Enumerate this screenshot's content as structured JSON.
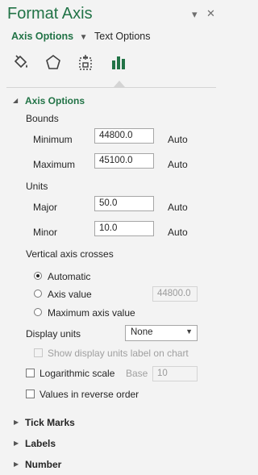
{
  "header": {
    "title": "Format Axis",
    "dropdown_icon": "chevron-down-icon",
    "close_icon": "close-icon"
  },
  "tabs": {
    "axis_options": "Axis Options",
    "text_options": "Text Options"
  },
  "icon_tabs": [
    "fill-line-icon",
    "effects-pentagon-icon",
    "size-properties-icon",
    "axis-options-bar-icon"
  ],
  "axis_options": {
    "section": "Axis Options",
    "bounds_heading": "Bounds",
    "minimum_label": "Minimum",
    "minimum_value": "44800.0",
    "minimum_auto": "Auto",
    "maximum_label": "Maximum",
    "maximum_value": "45100.0",
    "maximum_auto": "Auto",
    "units_heading": "Units",
    "major_label": "Major",
    "major_value": "50.0",
    "major_auto": "Auto",
    "minor_label": "Minor",
    "minor_value": "10.0",
    "minor_auto": "Auto",
    "crosses_heading": "Vertical axis crosses",
    "crosses_automatic": "Automatic",
    "crosses_axis_value": "Axis value",
    "crosses_axis_value_input": "44800.0",
    "crosses_maximum": "Maximum axis value",
    "display_units_label": "Display units",
    "display_units_value": "None",
    "show_units_label": "Show display units label on chart",
    "log_scale_label": "Logarithmic scale",
    "base_label": "Base",
    "base_value": "10",
    "reverse_label": "Values in reverse order"
  },
  "sections": {
    "tick_marks": "Tick Marks",
    "labels": "Labels",
    "number": "Number"
  },
  "colors": {
    "accent": "#217346",
    "background": "#f3f3f3"
  }
}
